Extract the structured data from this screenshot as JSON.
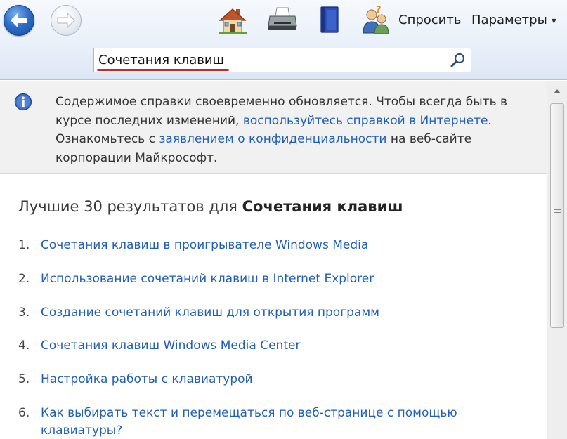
{
  "toolbar": {
    "back_icon": "back-arrow-icon",
    "forward_icon": "forward-arrow-icon",
    "home_icon": "home-icon",
    "print_icon": "printer-icon",
    "browse_icon": "book-icon",
    "ask_icon": "people-question-icon",
    "ask_label": "Спросить",
    "ask_label_first": "С",
    "ask_label_rest": "просить",
    "options_label_first": "П",
    "options_label_rest": "араметры",
    "options_arrow": "▾"
  },
  "search": {
    "value": "Сочетания клавиш",
    "icon": "search-icon"
  },
  "banner": {
    "icon": "info-icon",
    "text_1": "Содержимое справки своевременно обновляется. Чтобы всегда быть в курсе последних изменений, ",
    "link_1": "воспользуйтесь справкой в Интернете",
    "text_2": ".",
    "text_3": "Ознакомьтесь с ",
    "link_2": "заявлением о конфиденциальности",
    "text_4": " на веб-сайте корпорации Майкрософт."
  },
  "results": {
    "heading_prefix": "Лучшие 30 результатов для ",
    "heading_query": "Сочетания клавиш",
    "items": [
      {
        "num": "1.",
        "label": "Сочетания клавиш в проигрывателе Windows Media"
      },
      {
        "num": "2.",
        "label": "Использование сочетаний клавиш в Internet Explorer"
      },
      {
        "num": "3.",
        "label": "Создание сочетаний клавиш для открытия программ"
      },
      {
        "num": "4.",
        "label": "Сочетания клавиш Windows Media Center"
      },
      {
        "num": "5.",
        "label": "Настройка работы с клавиатурой"
      },
      {
        "num": "6.",
        "label": "Как выбирать текст и перемещаться по веб-странице с помощью клавиатуры?"
      }
    ]
  },
  "colors": {
    "link": "#1f5fb8",
    "search_underline": "#d92020"
  }
}
